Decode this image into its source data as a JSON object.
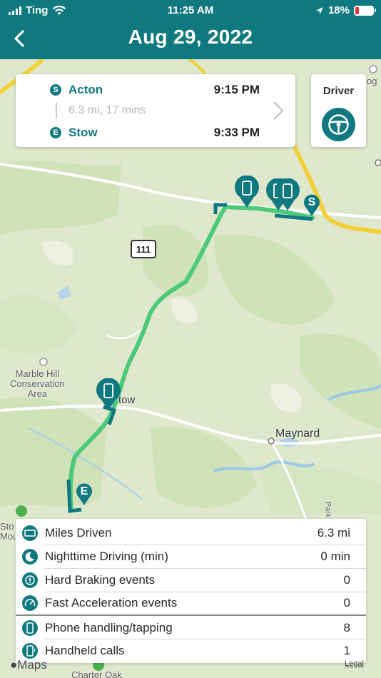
{
  "status": {
    "carrier": "Ting",
    "time": "11:25 AM",
    "battery": "18%"
  },
  "header": {
    "title": "Aug 29, 2022"
  },
  "trip": {
    "start_badge": "S",
    "start": "Acton",
    "start_time": "9:15 PM",
    "summary": "6.3 mi, 17 mins",
    "end_badge": "E",
    "end": "Stow",
    "end_time": "9:33 PM"
  },
  "driver": {
    "label": "Driver"
  },
  "map": {
    "route_number": "111",
    "labels": {
      "marble_hill": "Marble Hill\nConservation\nArea",
      "stow": "tow",
      "maynard": "Maynard",
      "stow_edge": "Sto\nMoun",
      "park": "Park",
      "charter_oak": "Charter Oak",
      "og": "og"
    },
    "start_marker": "S",
    "end_marker": "E",
    "attribution": "Maps",
    "legal": "Legal"
  },
  "stats": [
    {
      "icon": "odometer-icon",
      "label": "Miles Driven",
      "value": "6.3 mi"
    },
    {
      "icon": "moon-icon",
      "label": "Nighttime Driving (min)",
      "value": "0 min"
    },
    {
      "icon": "brake-warning-icon",
      "label": "Hard Braking events",
      "value": "0"
    },
    {
      "icon": "speedometer-icon",
      "label": "Fast Acceleration events",
      "value": "0"
    },
    {
      "icon": "phone-tap-icon",
      "label": "Phone handling/tapping",
      "value": "8"
    },
    {
      "icon": "phone-call-icon",
      "label": "Handheld calls",
      "value": "1"
    }
  ],
  "colors": {
    "brand": "#10797f",
    "route": "#4cc97a",
    "battery_low": "#e5343a"
  }
}
